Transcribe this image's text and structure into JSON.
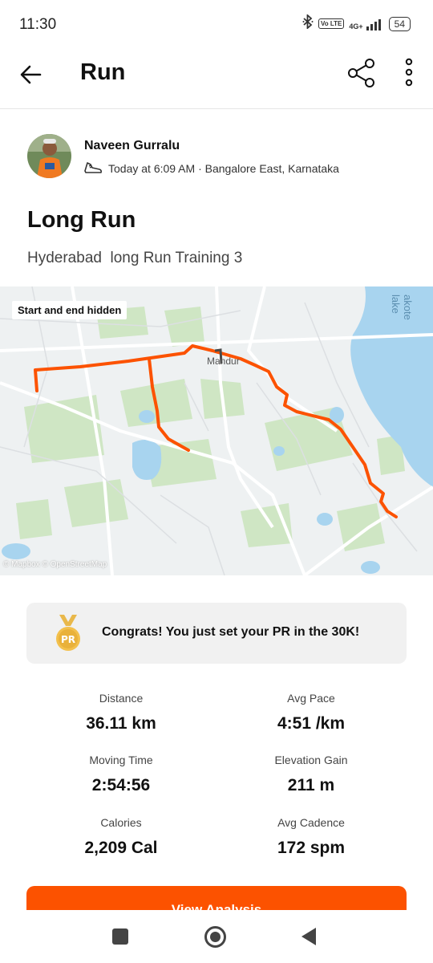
{
  "status_bar": {
    "time": "11:30",
    "bluetooth_icon": "bluetooth-icon",
    "volte": "Vo LTE",
    "network": "4G+",
    "battery": "54"
  },
  "app_bar": {
    "title": "Run",
    "back_icon": "arrow-left-icon",
    "share_icon": "share-icon",
    "more_icon": "more-vertical-icon"
  },
  "athlete": {
    "name": "Naveen Gurralu",
    "meta": "Today at 6:09 AM · Bangalore East, Karnataka"
  },
  "activity": {
    "title": "Long Run",
    "description": "Hyderabad  long Run Training 3"
  },
  "map": {
    "badge": "Start and end hidden",
    "attribution": "© Mapbox © OpenStreetMap",
    "town_label": "Mandur",
    "lake_label": "akote lake",
    "route_color": "#fc5200"
  },
  "pr": {
    "medal_label": "PR",
    "text": "Congrats! You just set your PR in the 30K!"
  },
  "stats": [
    {
      "label": "Distance",
      "value": "36.11 km"
    },
    {
      "label": "Avg Pace",
      "value": "4:51 /km"
    },
    {
      "label": "Moving Time",
      "value": "2:54:56"
    },
    {
      "label": "Elevation Gain",
      "value": "211 m"
    },
    {
      "label": "Calories",
      "value": "2,209 Cal"
    },
    {
      "label": "Avg Cadence",
      "value": "172 spm"
    }
  ],
  "actions": {
    "view_analysis": "View Analysis"
  },
  "colors": {
    "brand": "#fc5200",
    "card_bg": "#f1f1f1"
  }
}
